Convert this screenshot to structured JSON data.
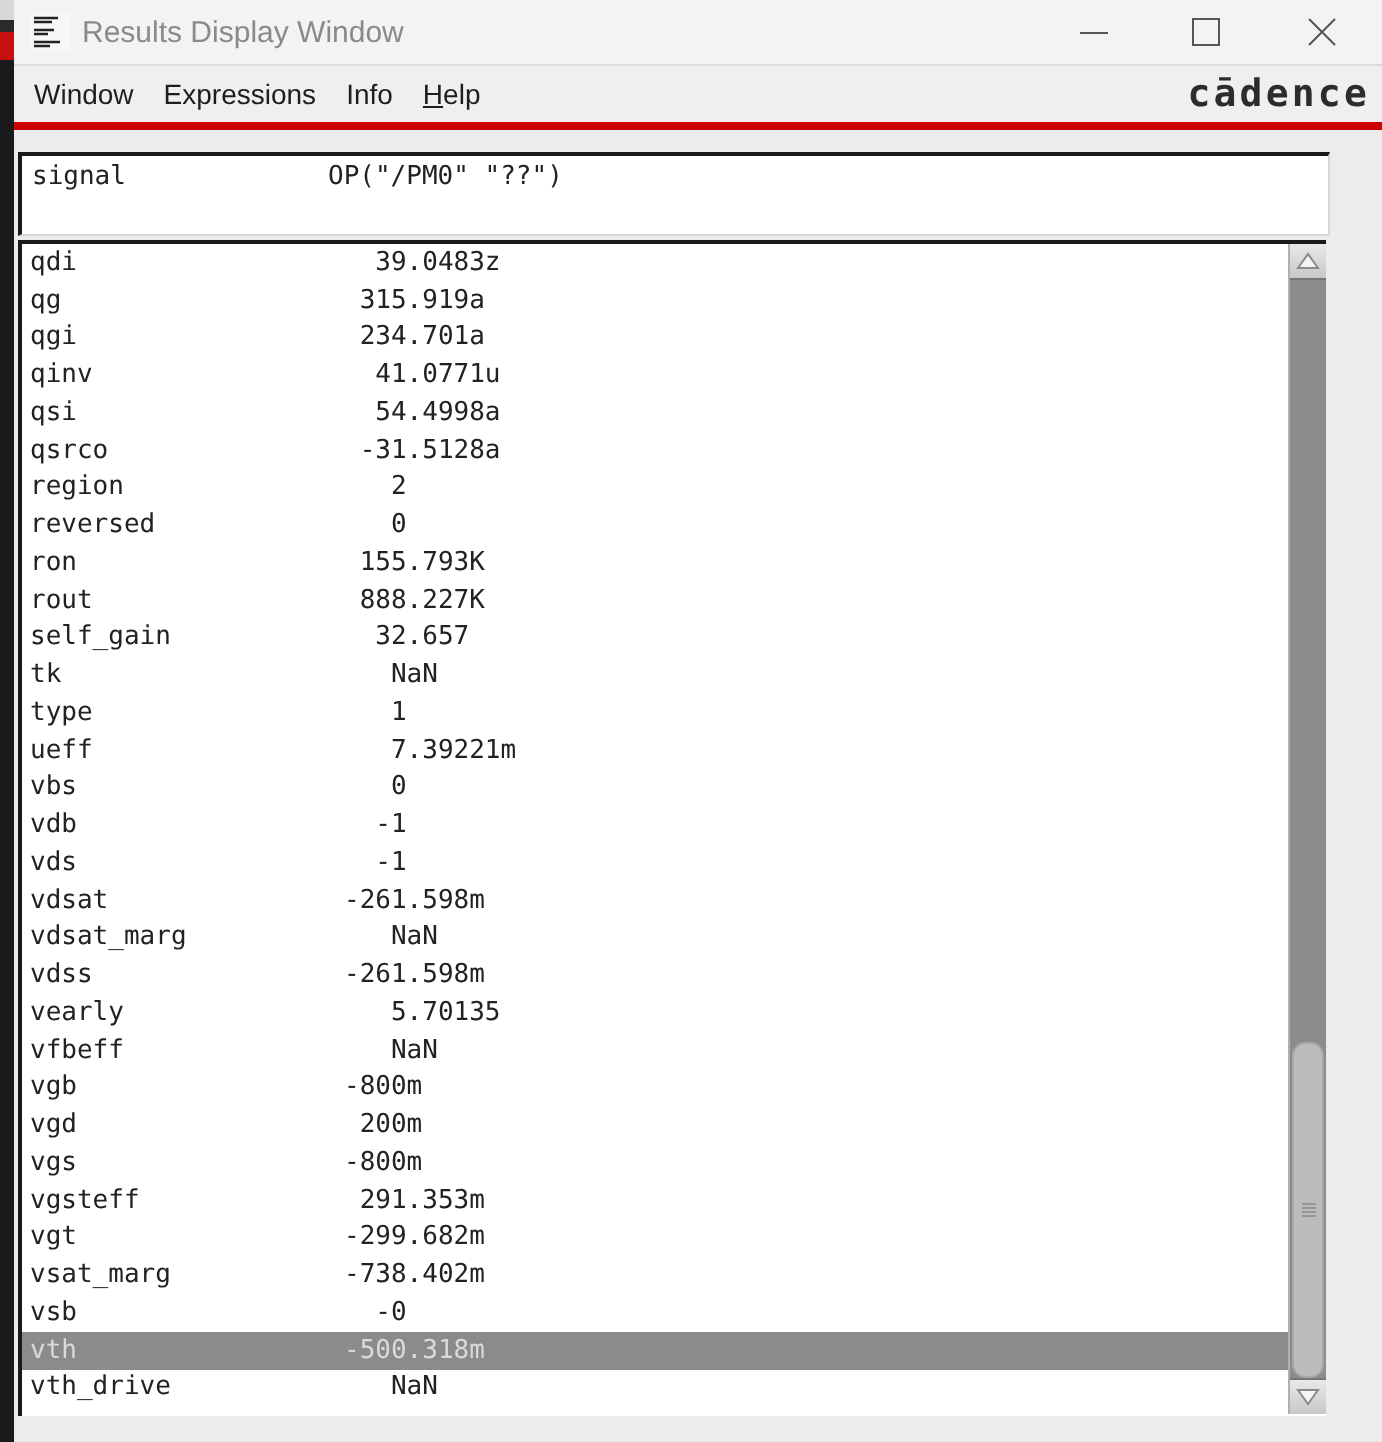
{
  "window": {
    "title": "Results Display Window"
  },
  "menu": [
    {
      "label": "Window",
      "mnemonic_underlined": false
    },
    {
      "label": "Expressions",
      "mnemonic_underlined": false
    },
    {
      "label": "Info",
      "mnemonic_underlined": false
    },
    {
      "label": "Help",
      "mnemonic_underlined": true
    }
  ],
  "logo": "cādence",
  "signal": {
    "label": "signal",
    "expression": "OP(\"/PM0\" \"??\")"
  },
  "rows": [
    {
      "name": "qdi",
      "value": "39.0483z",
      "selected": false
    },
    {
      "name": "qg",
      "value": "315.919a",
      "selected": false
    },
    {
      "name": "qgi",
      "value": "234.701a",
      "selected": false
    },
    {
      "name": "qinv",
      "value": "41.0771u",
      "selected": false
    },
    {
      "name": "qsi",
      "value": "54.4998a",
      "selected": false
    },
    {
      "name": "qsrco",
      "value": "-31.5128a",
      "selected": false
    },
    {
      "name": "region",
      "value": "2",
      "selected": false
    },
    {
      "name": "reversed",
      "value": "0",
      "selected": false
    },
    {
      "name": "ron",
      "value": "155.793K",
      "selected": false
    },
    {
      "name": "rout",
      "value": "888.227K",
      "selected": false
    },
    {
      "name": "self_gain",
      "value": "32.657",
      "selected": false
    },
    {
      "name": "tk",
      "value": "NaN",
      "selected": false
    },
    {
      "name": "type",
      "value": "1",
      "selected": false
    },
    {
      "name": "ueff",
      "value": "7.39221m",
      "selected": false
    },
    {
      "name": "vbs",
      "value": "0",
      "selected": false
    },
    {
      "name": "vdb",
      "value": "-1",
      "selected": false
    },
    {
      "name": "vds",
      "value": "-1",
      "selected": false
    },
    {
      "name": "vdsat",
      "value": "-261.598m",
      "selected": false
    },
    {
      "name": "vdsat_marg",
      "value": "NaN",
      "selected": false
    },
    {
      "name": "vdss",
      "value": "-261.598m",
      "selected": false
    },
    {
      "name": "vearly",
      "value": "5.70135",
      "selected": false
    },
    {
      "name": "vfbeff",
      "value": "NaN",
      "selected": false
    },
    {
      "name": "vgb",
      "value": "-800m",
      "selected": false
    },
    {
      "name": "vgd",
      "value": "200m",
      "selected": false
    },
    {
      "name": "vgs",
      "value": "-800m",
      "selected": false
    },
    {
      "name": "vgsteff",
      "value": "291.353m",
      "selected": false
    },
    {
      "name": "vgt",
      "value": "-299.682m",
      "selected": false
    },
    {
      "name": "vsat_marg",
      "value": "-738.402m",
      "selected": false
    },
    {
      "name": "vsb",
      "value": "-0",
      "selected": false
    },
    {
      "name": "vth",
      "value": "-500.318m",
      "selected": true
    },
    {
      "name": "vth_drive",
      "value": "NaN",
      "selected": false
    }
  ]
}
